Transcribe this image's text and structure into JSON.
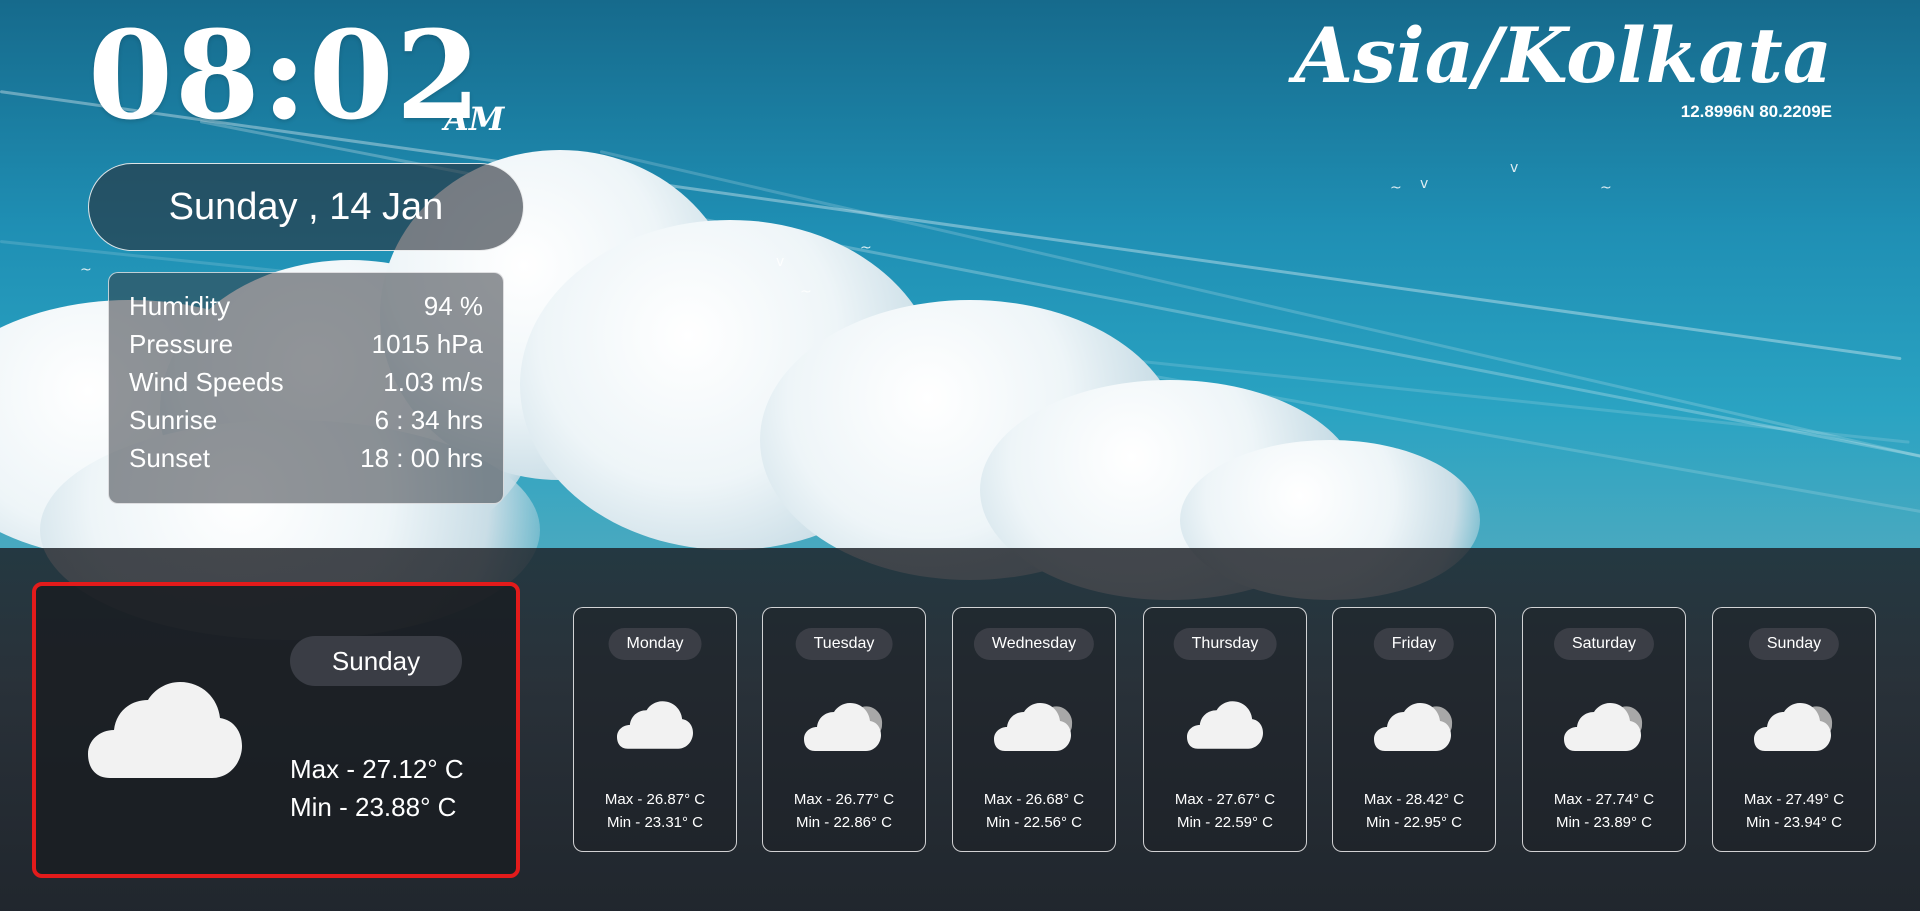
{
  "clock": {
    "time": "08:02",
    "ampm": "AM"
  },
  "date": "Sunday , 14 Jan",
  "location": {
    "timezone": "Asia/Kolkata",
    "coords": "12.8996N 80.2209E"
  },
  "details": [
    {
      "label": "Humidity",
      "value": "94 %"
    },
    {
      "label": "Pressure",
      "value": "1015 hPa"
    },
    {
      "label": "Wind Speeds",
      "value": "1.03 m/s"
    },
    {
      "label": "Sunrise",
      "value": "6 : 34 hrs"
    },
    {
      "label": "Sunset",
      "value": "18 : 00 hrs"
    }
  ],
  "today": {
    "day": "Sunday",
    "max": "Max - 27.12° C",
    "min": "Min - 23.88° C",
    "icon": "cloud-icon"
  },
  "forecast": [
    {
      "day": "Monday",
      "max": "Max - 26.87° C",
      "min": "Min - 23.31° C",
      "icon": "cloud-icon"
    },
    {
      "day": "Tuesday",
      "max": "Max - 26.77° C",
      "min": "Min - 22.86° C",
      "icon": "cloud-icon"
    },
    {
      "day": "Wednesday",
      "max": "Max - 26.68° C",
      "min": "Min - 22.56° C",
      "icon": "cloud-icon"
    },
    {
      "day": "Thursday",
      "max": "Max - 27.67° C",
      "min": "Min - 22.59° C",
      "icon": "cloud-icon"
    },
    {
      "day": "Friday",
      "max": "Max - 28.42° C",
      "min": "Min - 22.95° C",
      "icon": "cloud-icon"
    },
    {
      "day": "Saturday",
      "max": "Max - 27.74° C",
      "min": "Min - 23.89° C",
      "icon": "cloud-icon"
    },
    {
      "day": "Sunday",
      "max": "Max - 27.49° C",
      "min": "Min - 23.94° C",
      "icon": "cloud-icon"
    }
  ],
  "colors": {
    "highlight_border": "#e31b1b",
    "pill_bg": "#3a3d45"
  }
}
